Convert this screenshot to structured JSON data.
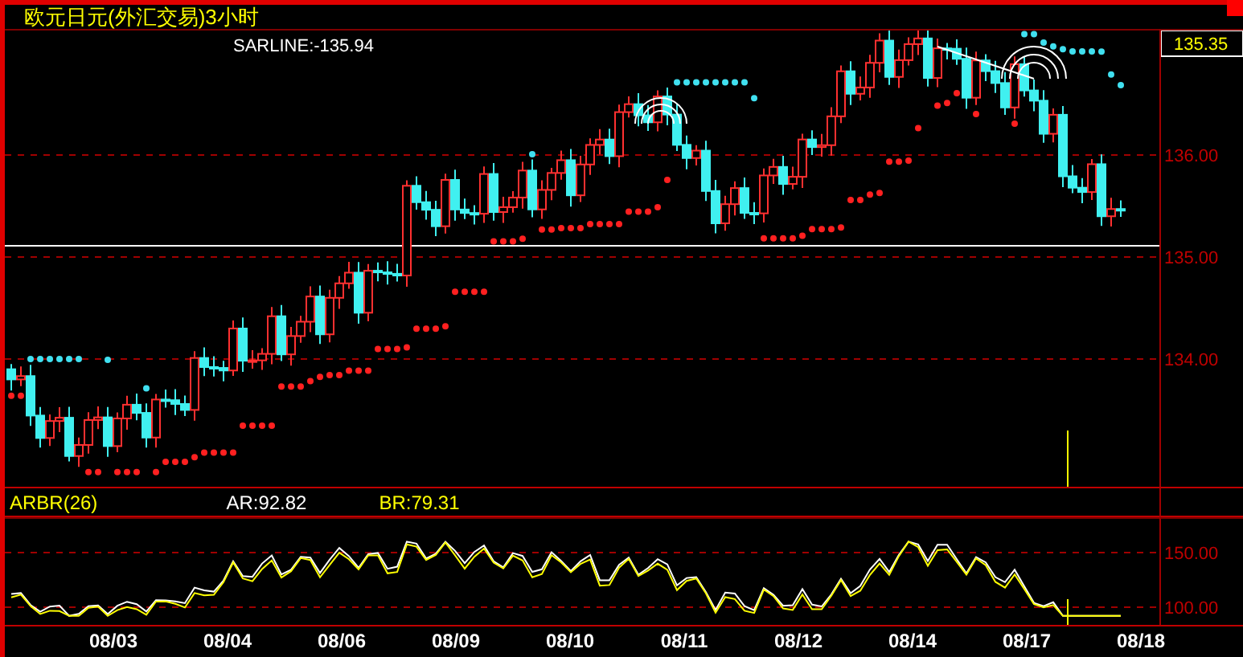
{
  "title": "欧元日元(外汇交易)3小时",
  "price_panel": {
    "indicator_label": "SARLINE:-135.94",
    "current_price": "135.35",
    "y_axis": [
      "136.00",
      "135.00",
      "134.00"
    ]
  },
  "indicator_panel": {
    "name": "ARBR(26)",
    "readouts": [
      {
        "text": "AR:92.82",
        "color": "#ffffff"
      },
      {
        "text": "BR:79.31",
        "color": "#ffff00"
      }
    ],
    "y_axis": [
      "150.00",
      "100.00"
    ]
  },
  "x_axis": [
    "08/03",
    "08/04",
    "08/06",
    "08/09",
    "08/10",
    "08/11",
    "08/12",
    "08/14",
    "08/17",
    "08/18"
  ]
}
